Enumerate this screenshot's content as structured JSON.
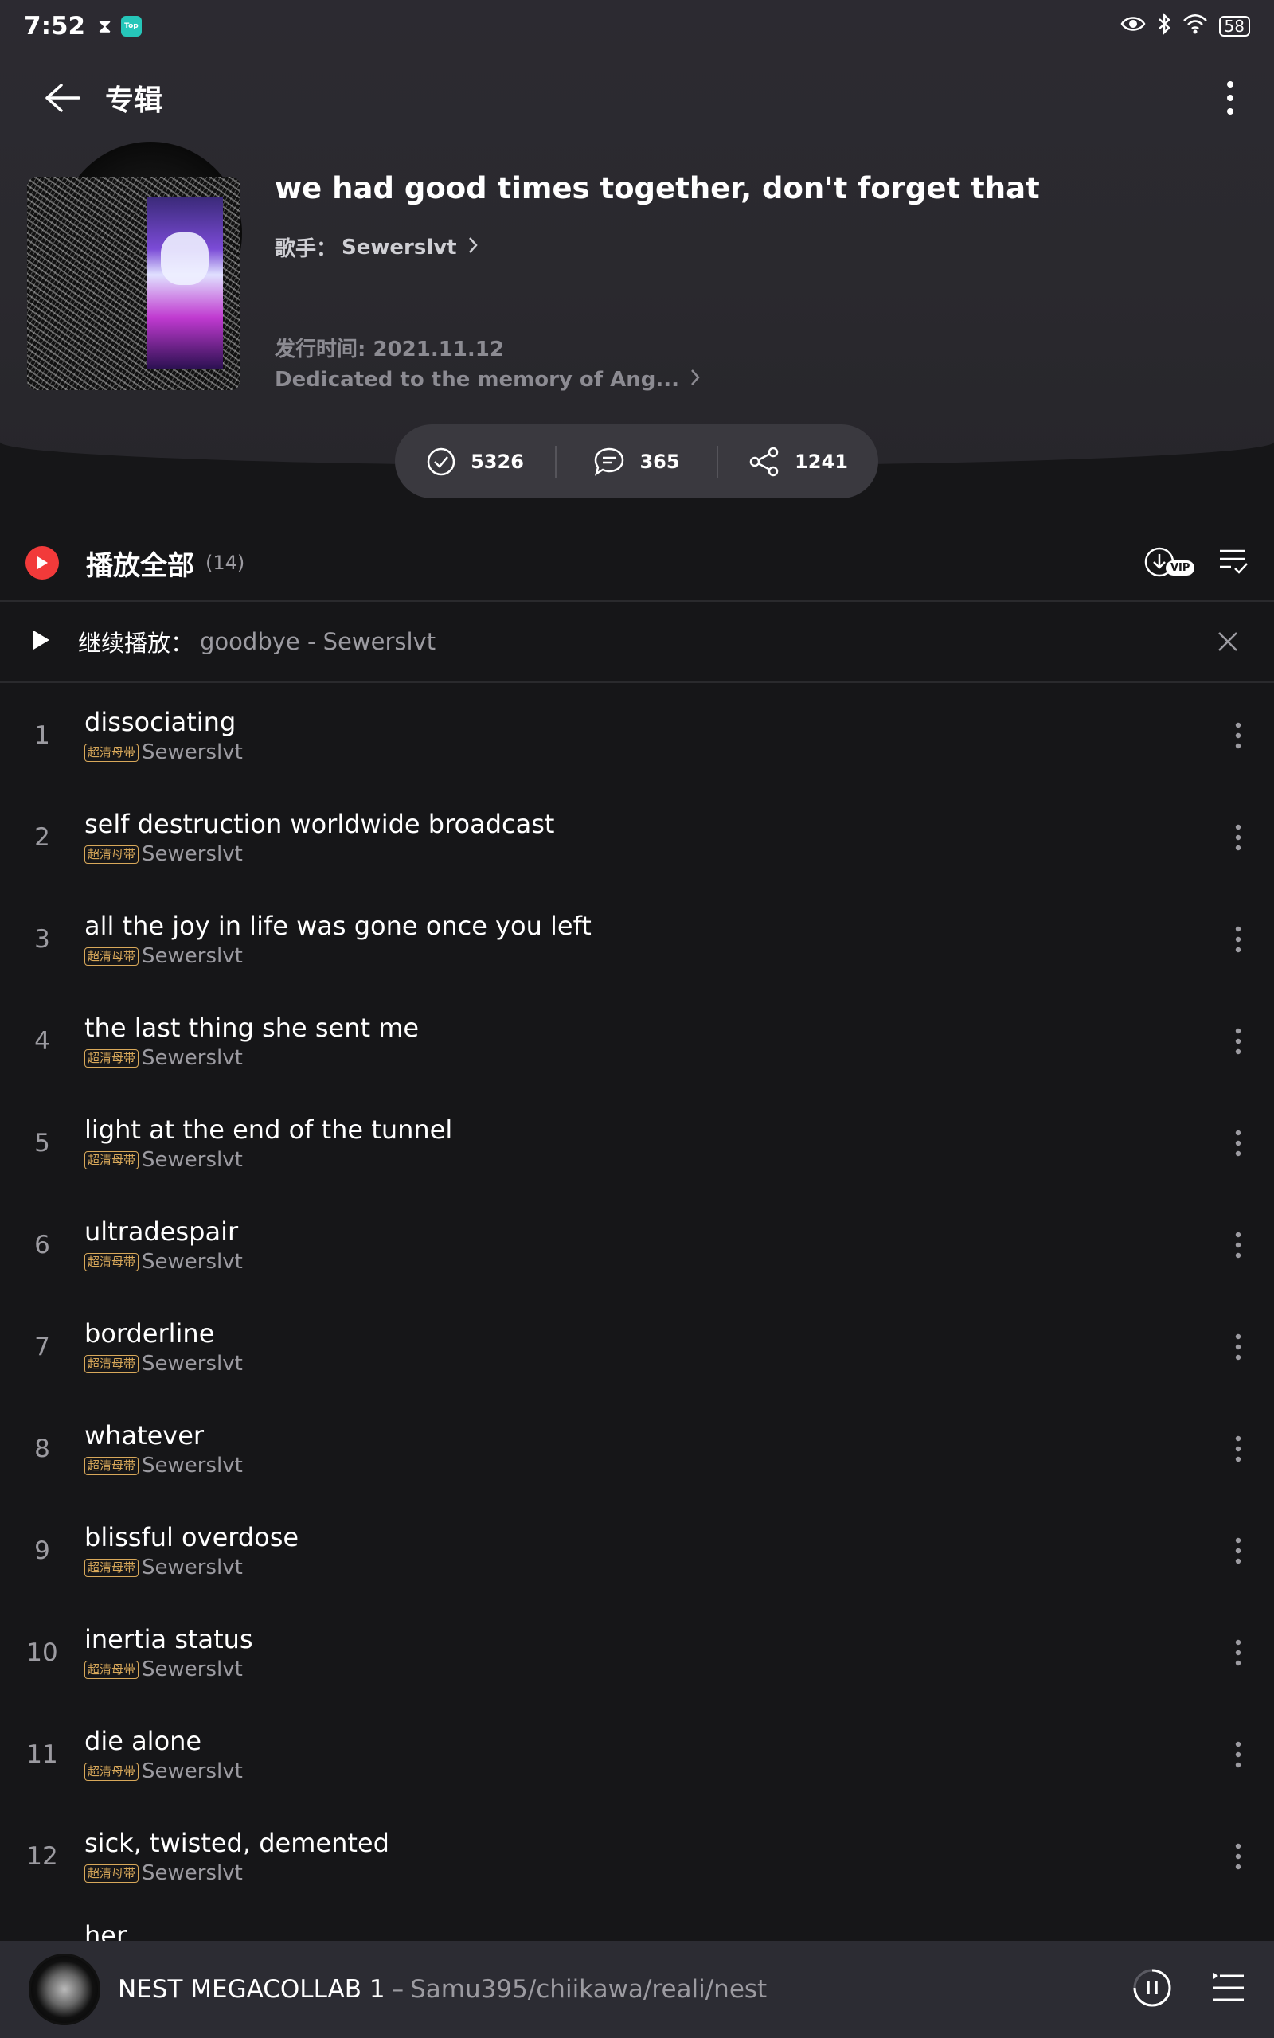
{
  "status_bar": {
    "time": "7:52",
    "hourglass_icon": "hourglass-icon",
    "app_badge": "Top",
    "battery": "58"
  },
  "top_bar": {
    "title": "专辑"
  },
  "album": {
    "title": "we had good times together, don't forget that",
    "artist_label": "歌手：",
    "artist": "Sewerslvt",
    "release": "发行时间: 2021.11.12",
    "description": "Dedicated to the memory of Ang..."
  },
  "stats": {
    "collect": "5326",
    "comments": "365",
    "shares": "1241"
  },
  "play_all": {
    "label": "播放全部",
    "count": "(14)",
    "vip_badge": "VIP"
  },
  "resume": {
    "label": "继续播放：",
    "song": "goodbye - Sewerslvt"
  },
  "tracks": [
    {
      "num": "1",
      "name": "dissociating",
      "badge": "超清母带",
      "artist": "Sewerslvt"
    },
    {
      "num": "2",
      "name": "self destruction worldwide broadcast",
      "badge": "超清母带",
      "artist": "Sewerslvt"
    },
    {
      "num": "3",
      "name": "all the joy in life was gone once you left",
      "badge": "超清母带",
      "artist": "Sewerslvt"
    },
    {
      "num": "4",
      "name": "the last thing she sent me",
      "badge": "超清母带",
      "artist": "Sewerslvt"
    },
    {
      "num": "5",
      "name": "light at the end of the tunnel",
      "badge": "超清母带",
      "artist": "Sewerslvt"
    },
    {
      "num": "6",
      "name": "ultradespair",
      "badge": "超清母带",
      "artist": "Sewerslvt"
    },
    {
      "num": "7",
      "name": "borderline",
      "badge": "超清母带",
      "artist": "Sewerslvt"
    },
    {
      "num": "8",
      "name": "whatever",
      "badge": "超清母带",
      "artist": "Sewerslvt"
    },
    {
      "num": "9",
      "name": "blissful overdose",
      "badge": "超清母带",
      "artist": "Sewerslvt"
    },
    {
      "num": "10",
      "name": "inertia status",
      "badge": "超清母带",
      "artist": "Sewerslvt"
    },
    {
      "num": "11",
      "name": "die alone",
      "badge": "超清母带",
      "artist": "Sewerslvt"
    },
    {
      "num": "12",
      "name": "sick, twisted, demented",
      "badge": "超清母带",
      "artist": "Sewerslvt"
    }
  ],
  "partial_track": "her",
  "mini_player": {
    "song": "NEST MEGACOLLAB 1",
    "separator": "–",
    "artist": "Samu395/chiikawa/reali/nest"
  }
}
